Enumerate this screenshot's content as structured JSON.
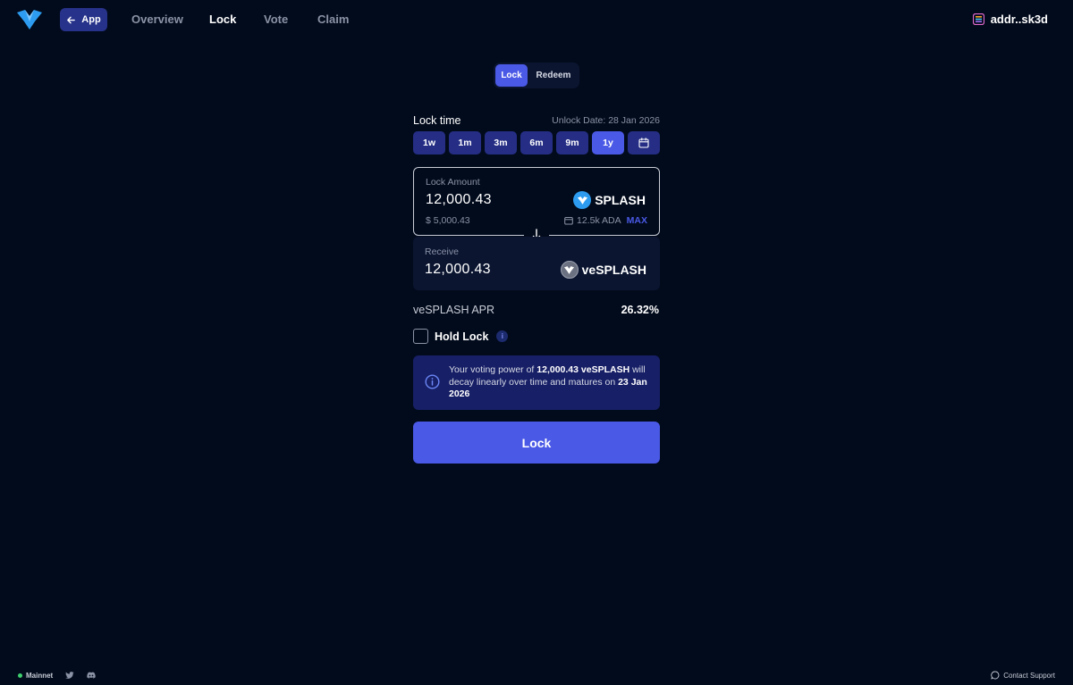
{
  "header": {
    "app_label": "App",
    "nav": [
      "Overview",
      "Lock",
      "Vote",
      "Claim"
    ],
    "active_nav": "Lock",
    "wallet": "addr..sk3d"
  },
  "tabs": {
    "lock": "Lock",
    "redeem": "Redeem",
    "active": "Lock"
  },
  "lock_time": {
    "label": "Lock time",
    "unlock_date": "Unlock Date: 28 Jan 2026",
    "periods": [
      "1w",
      "1m",
      "3m",
      "6m",
      "9m",
      "1y"
    ],
    "active_period": "1y",
    "calendar_icon": "calendar-icon"
  },
  "lock_amount": {
    "label": "Lock Amount",
    "value": "12,000.43",
    "usd": "$ 5,000.43",
    "token": "SPLASH",
    "balance": "12.5k ADA",
    "max": "MAX"
  },
  "receive": {
    "label": "Receive",
    "value": "12,000.43",
    "token": "veSPLASH"
  },
  "apr": {
    "label": "veSPLASH APR",
    "value": "26.32%"
  },
  "hold_lock": {
    "label": "Hold Lock",
    "checked": false
  },
  "notice": {
    "t1": "Your voting power of ",
    "b1": "12,000.43 veSPLASH",
    "t2": " will decay linearly over time and matures on ",
    "b2": "23 Jan 2026"
  },
  "submit_label": "Lock",
  "footer": {
    "network": "Mainnet",
    "support": "Contact Support"
  },
  "colors": {
    "background": "#020b1c",
    "accent": "#4a59e6",
    "period_bg": "#252e84",
    "notice_bg": "#171f66"
  }
}
